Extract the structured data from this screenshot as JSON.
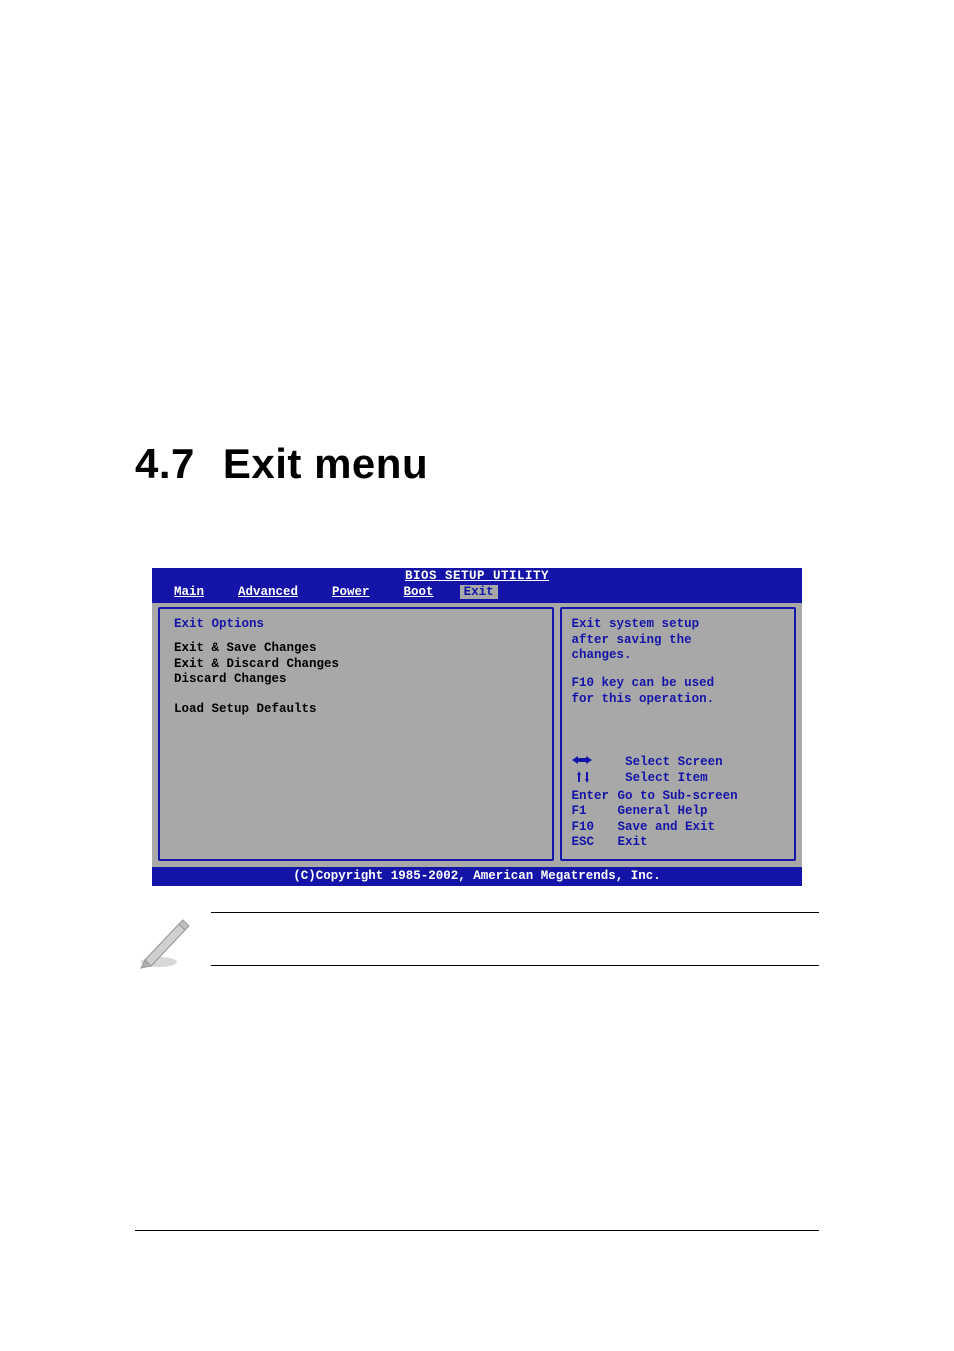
{
  "heading": {
    "number": "4.7",
    "title": "Exit menu"
  },
  "bios": {
    "title": "BIOS SETUP UTILITY",
    "tabs": {
      "main": "Main",
      "advanced": "Advanced",
      "power": "Power",
      "boot": "Boot",
      "exit": "Exit"
    },
    "exit_section_header": "Exit Options",
    "options": {
      "save": "Exit & Save Changes",
      "discard": "Exit & Discard Changes",
      "discard_only": "Discard Changes",
      "defaults": "Load Setup Defaults"
    },
    "help": {
      "line1": "Exit system setup",
      "line2": "after saving the",
      "line3": "changes.",
      "line4": "F10 key can be used",
      "line5": "for this operation."
    },
    "hints": {
      "arrows_lr_label": "Select Screen",
      "arrows_ud_label": "Select Item",
      "enter_key": "Enter",
      "enter_label": "Go to Sub-screen",
      "f1_key": "F1",
      "f1_label": "General Help",
      "f10_key": "F10",
      "f10_label": "Save and Exit",
      "esc_key": "ESC",
      "esc_label": "Exit"
    },
    "footer": "(C)Copyright 1985-2002, American Megatrends, Inc."
  }
}
